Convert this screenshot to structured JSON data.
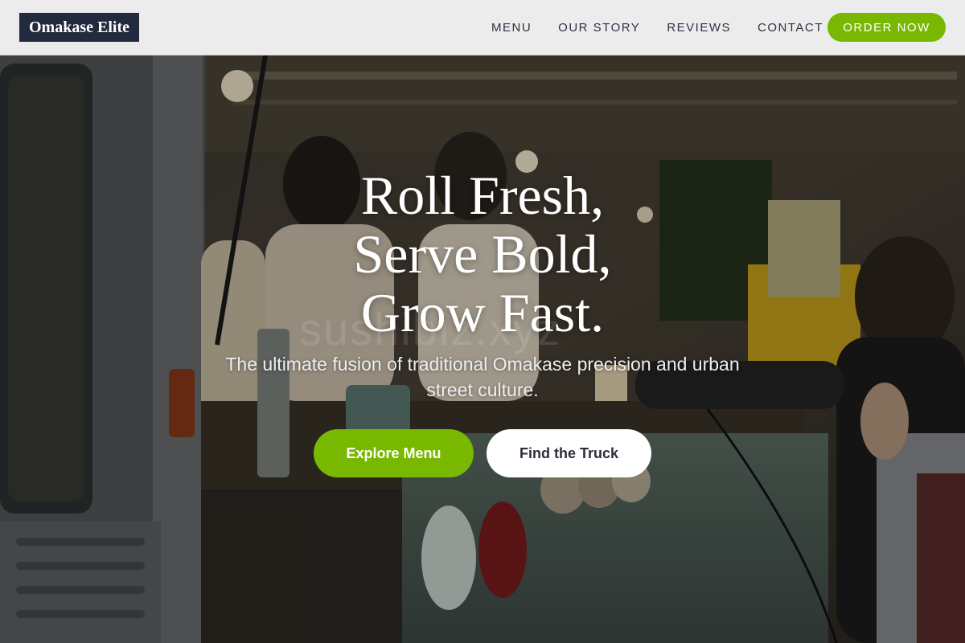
{
  "brand": {
    "name": "Omakase Elite"
  },
  "nav": {
    "items": [
      {
        "label": "MENU"
      },
      {
        "label": "OUR STORY"
      },
      {
        "label": "REVIEWS"
      },
      {
        "label": "CONTACT"
      }
    ],
    "cta_label": "ORDER NOW"
  },
  "hero": {
    "title_lines": [
      "Roll Fresh,",
      "Serve Bold,",
      "Grow Fast."
    ],
    "subtitle": "The ultimate fusion of traditional Omakase precision and urban street culture.",
    "primary_button": "Explore Menu",
    "secondary_button": "Find the Truck",
    "watermark": "sushibiz.xyz"
  },
  "colors": {
    "accent": "#78b800",
    "logo_bg": "#222b3d",
    "nav_bg": "#ececec",
    "nav_text": "#2d3342"
  }
}
